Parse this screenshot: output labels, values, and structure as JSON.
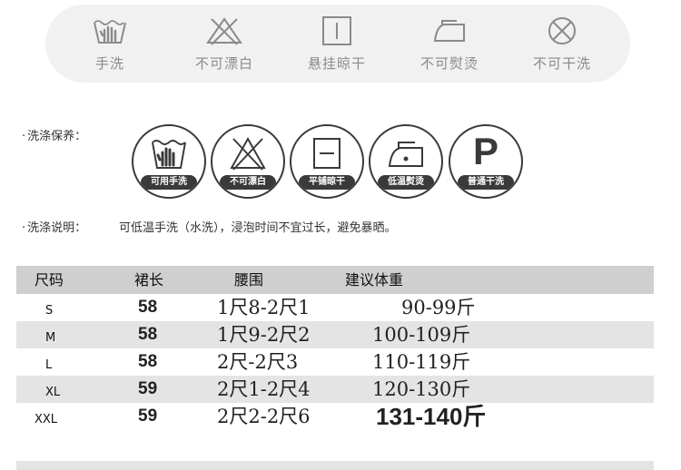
{
  "care_bar": {
    "items": [
      {
        "icon": "hand-wash-icon",
        "label": "手洗"
      },
      {
        "icon": "no-bleach-icon",
        "label": "不可漂白"
      },
      {
        "icon": "hang-dry-icon",
        "label": "悬挂晾干"
      },
      {
        "icon": "no-iron-icon",
        "label": "不可熨烫"
      },
      {
        "icon": "no-tumble-dry-icon",
        "label": "不可干洗"
      }
    ]
  },
  "care": {
    "label": "洗涤保养：",
    "icons": [
      {
        "icon": "hand-wash-icon",
        "label": "可用手洗"
      },
      {
        "icon": "no-bleach-icon",
        "label": "不可漂白"
      },
      {
        "icon": "flat-dry-icon",
        "label": "平铺晾干"
      },
      {
        "icon": "low-iron-icon",
        "label": "低温熨烫"
      },
      {
        "icon": "dry-clean-p-icon",
        "label": "普通干洗",
        "letter": "P"
      }
    ]
  },
  "instructions": {
    "label": "洗涤说明：",
    "text": "可低温手洗（水洗），浸泡时间不宜过长，避免暴晒。"
  },
  "table": {
    "headers": {
      "size": "尺码",
      "length": "裙长",
      "waist": "腰围",
      "weight": "建议体重"
    },
    "rows": [
      {
        "size": "S",
        "length": "58",
        "waist": "1尺8-2尺1",
        "weight": "90-99斤"
      },
      {
        "size": "M",
        "length": "58",
        "waist": "1尺9-2尺2",
        "weight": "100-109斤"
      },
      {
        "size": "L",
        "length": "58",
        "waist": "2尺-2尺3",
        "weight": "110-119斤"
      },
      {
        "size": "XL",
        "length": "59",
        "waist": "2尺1-2尺4",
        "weight": "120-130斤"
      },
      {
        "size": "XXL",
        "length": "59",
        "waist": "2尺2-2尺6",
        "weight": "131-140斤"
      }
    ]
  }
}
